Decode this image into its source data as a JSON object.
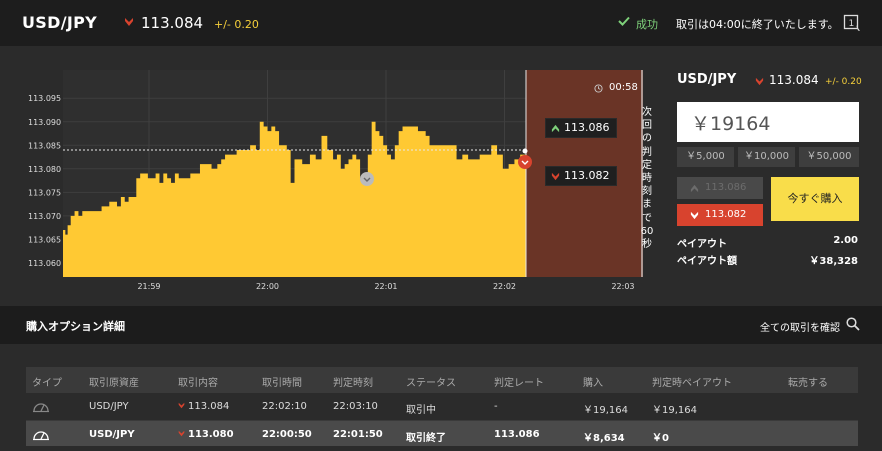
{
  "header": {
    "pair": "USD/JPY",
    "rate": "113.084",
    "change": "+/- 0.20",
    "success_label": "成功",
    "notice": "取引は04:00に終了いたします。"
  },
  "chart_data": {
    "type": "area",
    "title": "",
    "xlabel": "",
    "ylabel": "",
    "ylim": [
      113.057,
      113.101
    ],
    "yticks": [
      "113.095",
      "113.090",
      "113.085",
      "113.080",
      "113.075",
      "113.070",
      "113.065",
      "113.060"
    ],
    "xticks": [
      "21:59",
      "22:00",
      "22:01",
      "22:02",
      "22:03"
    ],
    "reference_level": 113.084,
    "series": [
      {
        "name": "",
        "color": "#ffc933",
        "t_minutes": [
          0.0,
          0.06,
          0.12,
          0.2,
          0.3,
          0.4,
          0.5,
          0.6,
          0.7,
          0.85,
          1.0,
          1.1,
          1.2,
          1.3,
          1.4,
          1.5,
          1.6,
          1.7,
          1.8,
          1.9,
          2.0,
          2.1,
          2.2,
          2.3,
          2.4,
          2.5,
          2.6,
          2.7,
          2.8,
          2.9,
          3.0,
          3.1,
          3.2,
          3.3,
          3.4,
          3.55,
          3.7,
          3.85,
          4.0,
          4.1,
          4.2,
          4.35,
          4.5,
          4.6,
          4.7,
          4.85,
          5.0,
          5.1,
          5.2,
          5.3,
          5.4,
          5.5,
          5.6,
          5.7,
          5.8,
          5.9,
          6.0,
          6.1,
          6.2,
          6.3,
          6.4,
          6.55,
          6.7,
          6.85,
          7.0,
          7.1,
          7.2,
          7.3,
          7.4,
          7.5,
          7.6,
          7.7,
          7.8,
          7.9,
          8.0,
          8.1,
          8.2,
          8.3,
          8.4,
          8.5,
          8.6,
          8.7,
          8.8,
          8.9,
          9.0,
          9.1,
          9.2,
          9.3,
          9.4,
          9.5,
          9.6,
          9.75,
          9.9,
          10.05,
          10.2,
          10.35,
          10.5,
          10.65,
          10.8,
          10.95,
          11.1,
          11.25,
          11.4,
          11.55,
          11.7,
          11.85,
          12.0
        ],
        "values": [
          113.067,
          113.066,
          113.068,
          113.07,
          113.071,
          113.07,
          113.071,
          113.071,
          113.071,
          113.071,
          113.072,
          113.072,
          113.073,
          113.073,
          113.072,
          113.074,
          113.073,
          113.074,
          113.074,
          113.078,
          113.079,
          113.079,
          113.078,
          113.078,
          113.079,
          113.077,
          113.079,
          113.078,
          113.077,
          113.079,
          113.078,
          113.078,
          113.078,
          113.079,
          113.079,
          113.081,
          113.081,
          113.08,
          113.081,
          113.082,
          113.083,
          113.083,
          113.084,
          113.084,
          113.084,
          113.085,
          113.084,
          113.09,
          113.089,
          113.088,
          113.089,
          113.088,
          113.085,
          113.085,
          113.084,
          113.077,
          113.082,
          113.082,
          113.081,
          113.081,
          113.083,
          113.082,
          113.087,
          113.084,
          113.082,
          113.083,
          113.08,
          113.081,
          113.082,
          113.083,
          113.082,
          113.078,
          113.077,
          113.083,
          113.09,
          113.088,
          113.087,
          113.085,
          113.083,
          113.082,
          113.085,
          113.088,
          113.089,
          113.089,
          113.089,
          113.089,
          113.088,
          113.088,
          113.087,
          113.085,
          113.085,
          113.085,
          113.085,
          113.085,
          113.082,
          113.083,
          113.082,
          113.082,
          113.083,
          113.083,
          113.085,
          113.083,
          113.08,
          113.081,
          113.082,
          113.083,
          113.087
        ]
      }
    ]
  },
  "chart": {
    "timer": "00:58",
    "vertical_label": "次回の判定時刻まで60秒",
    "high_tag": "113.086",
    "low_tag": "113.082"
  },
  "panel": {
    "pair": "USD/JPY",
    "rate": "113.084",
    "change": "+/- 0.20",
    "amount": "￥19164",
    "presets": [
      "￥5,000",
      "￥10,000",
      "￥50,000"
    ],
    "high_button": "113.086",
    "low_button": "113.082",
    "buy_button": "今すぐ購入",
    "payout_label": "ペイアウト",
    "payout_value": "2.00",
    "payout_amount_label": "ペイアウト額",
    "payout_amount_value": "￥38,328"
  },
  "details": {
    "title": "購入オプション詳細",
    "link": "全ての取引を確認",
    "columns": [
      "タイプ",
      "取引原資産",
      "取引内容",
      "取引時間",
      "判定時刻",
      "ステータス",
      "判定レート",
      "購入",
      "判定時ペイアウト",
      "転売する"
    ],
    "rows": [
      [
        "",
        "USD/JPY",
        "113.084",
        "22:02:10",
        "22:03:10",
        "取引中",
        "-",
        "￥19,164",
        "￥19,164",
        ""
      ],
      [
        "",
        "USD/JPY",
        "113.080",
        "22:00:50",
        "22:01:50",
        "取引終了",
        "113.086",
        "￥8,634",
        "￥0",
        ""
      ]
    ]
  },
  "colors": {
    "accent_yellow": "#f9dd4a",
    "area_fill": "#ffc933",
    "low_red": "#d8432e",
    "success_green": "#7ed17a"
  },
  "icons": {
    "down_arrow": "red-down-arrow-icon",
    "up_arrow": "green-up-arrow-icon",
    "check": "check-icon",
    "clock": "clock-icon",
    "search": "search-icon",
    "messages": "message-icon",
    "gauge": "gauge-icon"
  }
}
